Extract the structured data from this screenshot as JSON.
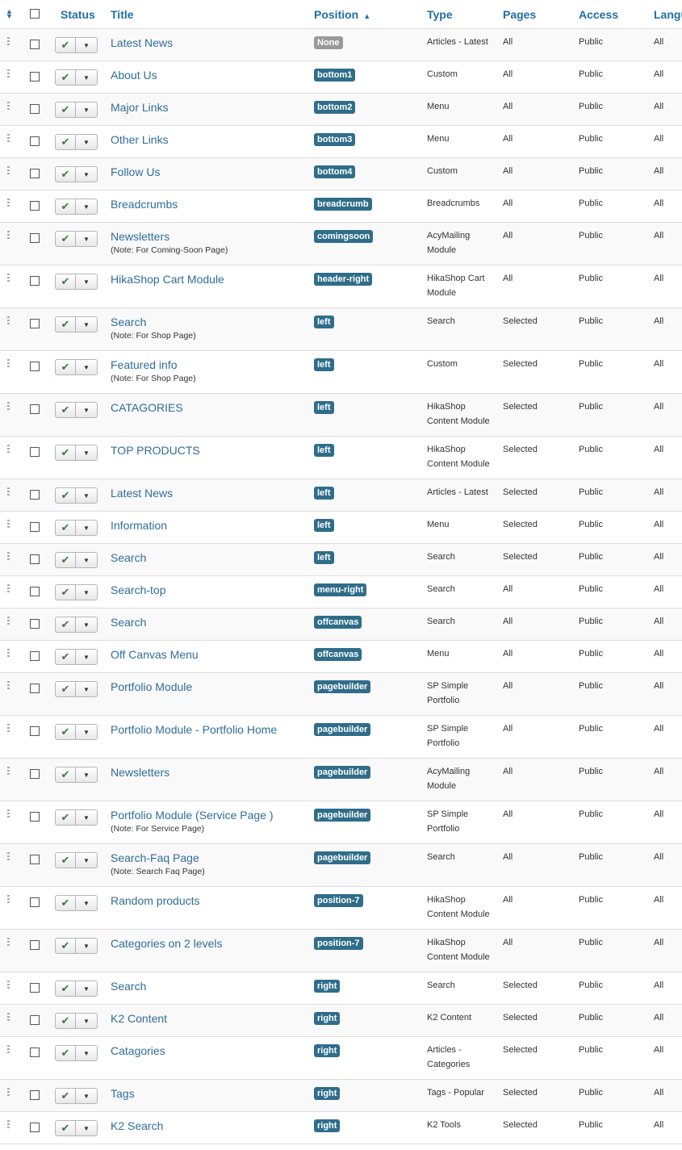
{
  "headers": {
    "status": "Status",
    "title": "Title",
    "position": "Position",
    "type": "Type",
    "pages": "Pages",
    "access": "Access",
    "language": "Langu"
  },
  "colors": {
    "link": "#2f6d9a",
    "badge": "#2f6d8a",
    "badge_none": "#999999",
    "check": "#378137"
  },
  "icons": {
    "sort": "sort-icon",
    "sort_asc": "caret-up-icon",
    "drag": "drag-handle-icon",
    "check": "check-icon",
    "caret": "caret-down-icon"
  },
  "rows": [
    {
      "title": "Latest News",
      "note": "",
      "position": "None",
      "type": "Articles - Latest",
      "pages": "All",
      "access": "Public",
      "language": "All"
    },
    {
      "title": "About Us",
      "note": "",
      "position": "bottom1",
      "type": "Custom",
      "pages": "All",
      "access": "Public",
      "language": "All"
    },
    {
      "title": "Major Links",
      "note": "",
      "position": "bottom2",
      "type": "Menu",
      "pages": "All",
      "access": "Public",
      "language": "All"
    },
    {
      "title": "Other Links",
      "note": "",
      "position": "bottom3",
      "type": "Menu",
      "pages": "All",
      "access": "Public",
      "language": "All"
    },
    {
      "title": "Follow Us",
      "note": "",
      "position": "bottom4",
      "type": "Custom",
      "pages": "All",
      "access": "Public",
      "language": "All"
    },
    {
      "title": "Breadcrumbs",
      "note": "",
      "position": "breadcrumb",
      "type": "Breadcrumbs",
      "pages": "All",
      "access": "Public",
      "language": "All"
    },
    {
      "title": "Newsletters",
      "note": "(Note: For Coming-Soon Page)",
      "position": "comingsoon",
      "type": "AcyMailing Module",
      "pages": "All",
      "access": "Public",
      "language": "All"
    },
    {
      "title": "HikaShop Cart Module",
      "note": "",
      "position": "header-right",
      "type": "HikaShop Cart Module",
      "pages": "All",
      "access": "Public",
      "language": "All"
    },
    {
      "title": "Search",
      "note": "(Note: For Shop Page)",
      "position": "left",
      "type": "Search",
      "pages": "Selected",
      "access": "Public",
      "language": "All"
    },
    {
      "title": "Featured info",
      "note": "(Note: For Shop Page)",
      "position": "left",
      "type": "Custom",
      "pages": "Selected",
      "access": "Public",
      "language": "All"
    },
    {
      "title": "CATAGORIES",
      "note": "",
      "position": "left",
      "type": "HikaShop Content Module",
      "pages": "Selected",
      "access": "Public",
      "language": "All"
    },
    {
      "title": "TOP PRODUCTS",
      "note": "",
      "position": "left",
      "type": "HikaShop Content Module",
      "pages": "Selected",
      "access": "Public",
      "language": "All"
    },
    {
      "title": "Latest News",
      "note": "",
      "position": "left",
      "type": "Articles - Latest",
      "pages": "Selected",
      "access": "Public",
      "language": "All"
    },
    {
      "title": "Information",
      "note": "",
      "position": "left",
      "type": "Menu",
      "pages": "Selected",
      "access": "Public",
      "language": "All"
    },
    {
      "title": "Search",
      "note": "",
      "position": "left",
      "type": "Search",
      "pages": "Selected",
      "access": "Public",
      "language": "All"
    },
    {
      "title": "Search-top",
      "note": "",
      "position": "menu-right",
      "type": "Search",
      "pages": "All",
      "access": "Public",
      "language": "All"
    },
    {
      "title": "Search",
      "note": "",
      "position": "offcanvas",
      "type": "Search",
      "pages": "All",
      "access": "Public",
      "language": "All"
    },
    {
      "title": "Off Canvas Menu",
      "note": "",
      "position": "offcanvas",
      "type": "Menu",
      "pages": "All",
      "access": "Public",
      "language": "All"
    },
    {
      "title": "Portfolio Module",
      "note": "",
      "position": "pagebuilder",
      "type": "SP Simple Portfolio",
      "pages": "All",
      "access": "Public",
      "language": "All"
    },
    {
      "title": "Portfolio Module - Portfolio Home",
      "note": "",
      "position": "pagebuilder",
      "type": "SP Simple Portfolio",
      "pages": "All",
      "access": "Public",
      "language": "All"
    },
    {
      "title": "Newsletters",
      "note": "",
      "position": "pagebuilder",
      "type": "AcyMailing Module",
      "pages": "All",
      "access": "Public",
      "language": "All"
    },
    {
      "title": "Portfolio Module (Service Page )",
      "note": "(Note: For Service Page)",
      "position": "pagebuilder",
      "type": "SP Simple Portfolio",
      "pages": "All",
      "access": "Public",
      "language": "All"
    },
    {
      "title": "Search-Faq Page",
      "note": "(Note: Search Faq Page)",
      "position": "pagebuilder",
      "type": "Search",
      "pages": "All",
      "access": "Public",
      "language": "All"
    },
    {
      "title": "Random products",
      "note": "",
      "position": "position-7",
      "type": "HikaShop Content Module",
      "pages": "All",
      "access": "Public",
      "language": "All"
    },
    {
      "title": "Categories on 2 levels",
      "note": "",
      "position": "position-7",
      "type": "HikaShop Content Module",
      "pages": "All",
      "access": "Public",
      "language": "All"
    },
    {
      "title": "Search",
      "note": "",
      "position": "right",
      "type": "Search",
      "pages": "Selected",
      "access": "Public",
      "language": "All"
    },
    {
      "title": "K2 Content",
      "note": "",
      "position": "right",
      "type": "K2 Content",
      "pages": "Selected",
      "access": "Public",
      "language": "All"
    },
    {
      "title": "Catagories",
      "note": "",
      "position": "right",
      "type": "Articles - Categories",
      "pages": "Selected",
      "access": "Public",
      "language": "All"
    },
    {
      "title": "Tags",
      "note": "",
      "position": "right",
      "type": "Tags - Popular",
      "pages": "Selected",
      "access": "Public",
      "language": "All"
    },
    {
      "title": "K2 Search",
      "note": "",
      "position": "right",
      "type": "K2 Tools",
      "pages": "Selected",
      "access": "Public",
      "language": "All"
    }
  ]
}
